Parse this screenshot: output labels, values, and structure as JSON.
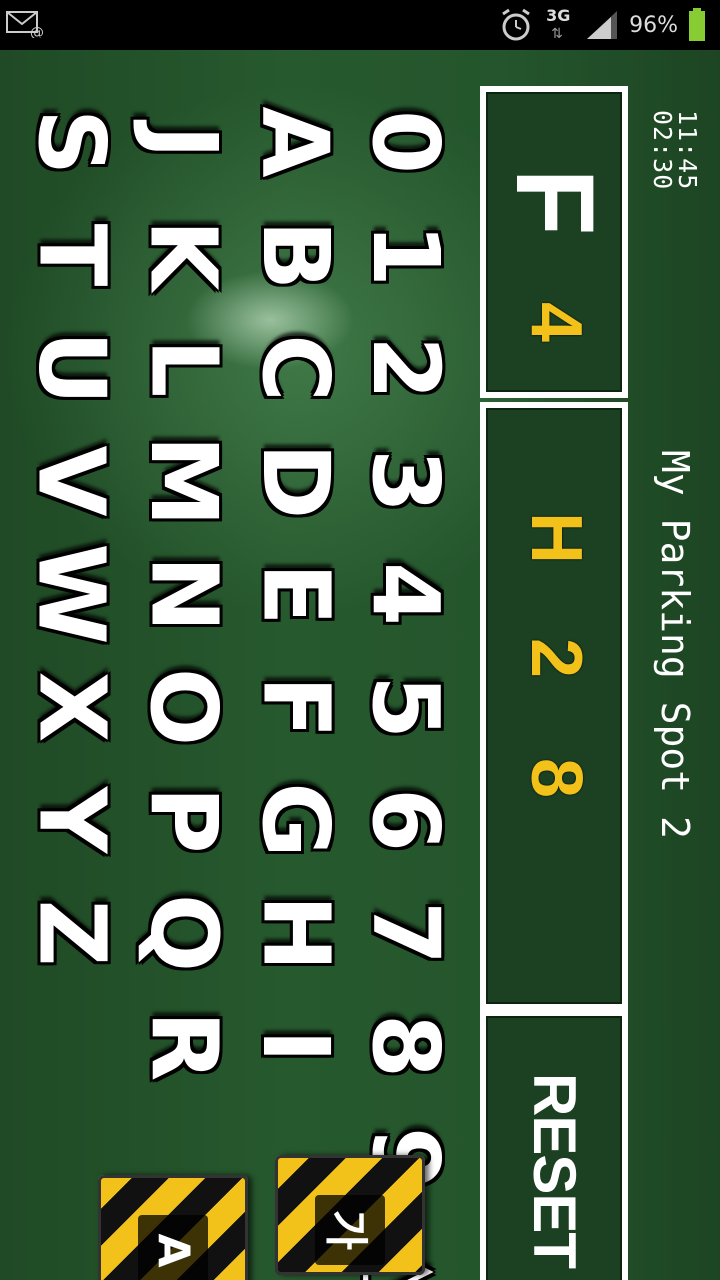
{
  "status_bar": {
    "battery_percent": "96%",
    "network": "3G",
    "icons": [
      "email-icon",
      "alarm-icon",
      "signal-icon",
      "battery-icon"
    ],
    "battery_level": 0.96
  },
  "clock": {
    "current_time": "11:45",
    "elapsed": "02:30"
  },
  "title": "My Parking Spot 2",
  "floor": {
    "letter": "F",
    "number": "4"
  },
  "spot": {
    "chars": [
      "H",
      "2",
      "8"
    ]
  },
  "reset_label": "RESET",
  "keypad": {
    "digits": [
      "0",
      "1",
      "2",
      "3",
      "4",
      "5",
      "6",
      "7",
      "8",
      "9",
      "△"
    ],
    "row_a": [
      "A",
      "B",
      "C",
      "D",
      "E",
      "F",
      "G",
      "H",
      "I"
    ],
    "row_j": [
      "J",
      "K",
      "L",
      "M",
      "N",
      "O",
      "P",
      "Q",
      "R"
    ],
    "row_s": [
      "S",
      "T",
      "U",
      "V",
      "W",
      "X",
      "Y",
      "Z"
    ]
  },
  "mode_buttons": {
    "korean": "가",
    "english": "A"
  },
  "colors": {
    "board_green": "#24552c",
    "accent_yellow": "#f2c21b",
    "panel_border": "#ffffff"
  }
}
